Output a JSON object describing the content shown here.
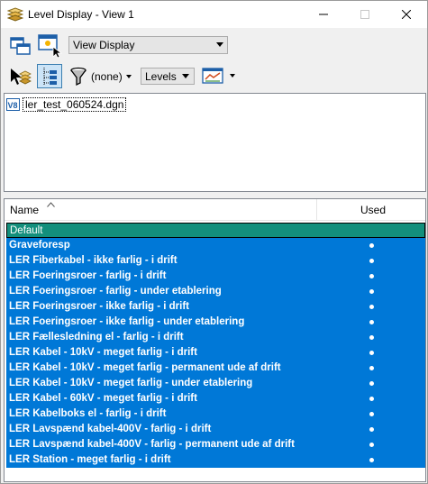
{
  "window": {
    "title": "Level Display - View 1"
  },
  "toolbar": {
    "display_mode": "View Display",
    "filter_value": "(none)",
    "levels_label": "Levels"
  },
  "files": {
    "items": [
      "ler_test_060524.dgn"
    ]
  },
  "levels_table": {
    "columns": {
      "name": "Name",
      "used": "Used"
    },
    "group": "Default",
    "rows": [
      {
        "name": "Graveforesp",
        "used": true
      },
      {
        "name": "LER Fiberkabel - ikke farlig - i drift",
        "used": true
      },
      {
        "name": "LER Foeringsroer - farlig - i drift",
        "used": true
      },
      {
        "name": "LER Foeringsroer - farlig - under etablering",
        "used": true
      },
      {
        "name": "LER Foeringsroer - ikke farlig - i drift",
        "used": true
      },
      {
        "name": "LER Foeringsroer - ikke farlig - under etablering",
        "used": true
      },
      {
        "name": "LER Fællesledning el - farlig - i drift",
        "used": true
      },
      {
        "name": "LER Kabel - 10kV - meget farlig - i drift",
        "used": true
      },
      {
        "name": "LER Kabel - 10kV - meget farlig - permanent ude af drift",
        "used": true
      },
      {
        "name": "LER Kabel - 10kV - meget farlig - under etablering",
        "used": true
      },
      {
        "name": "LER Kabel - 60kV - meget farlig - i drift",
        "used": true
      },
      {
        "name": "LER Kabelboks el - farlig - i drift",
        "used": true
      },
      {
        "name": "LER Lavspænd kabel-400V - farlig - i drift",
        "used": true
      },
      {
        "name": "LER Lavspænd kabel-400V - farlig - permanent ude af drift",
        "used": true
      },
      {
        "name": "LER Station - meget farlig - i drift",
        "used": true
      }
    ]
  },
  "colors": {
    "selection": "#0078d7",
    "group_row": "#138f7c"
  }
}
